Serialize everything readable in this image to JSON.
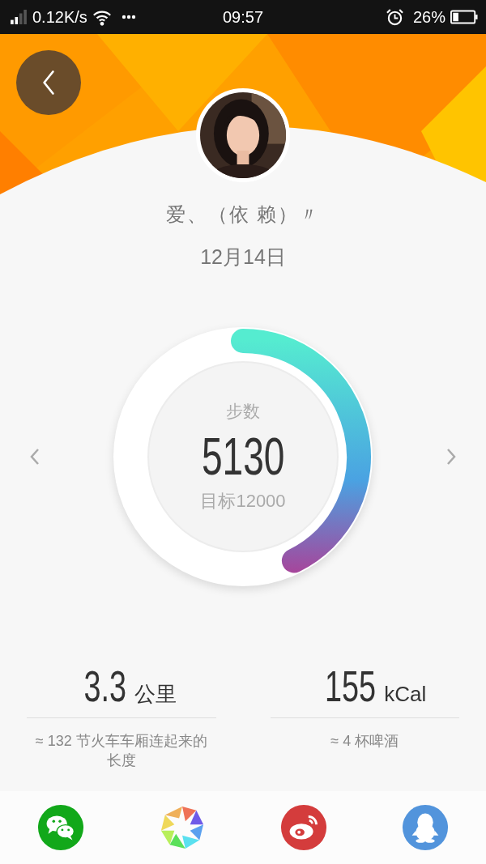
{
  "status_bar": {
    "network_speed": "0.12K/s",
    "time": "09:57",
    "battery": "26%"
  },
  "profile": {
    "name": "爱、（依 赖）〃",
    "date": "12月14日"
  },
  "steps": {
    "label": "步数",
    "value": "5130",
    "goal": "目标12000"
  },
  "stats": [
    {
      "value": "3.3",
      "unit": "公里",
      "description": "≈ 132  节火车车厢连起来的长度"
    },
    {
      "value": "155",
      "unit": "kCal",
      "description": "≈ 4 杯啤酒"
    }
  ]
}
